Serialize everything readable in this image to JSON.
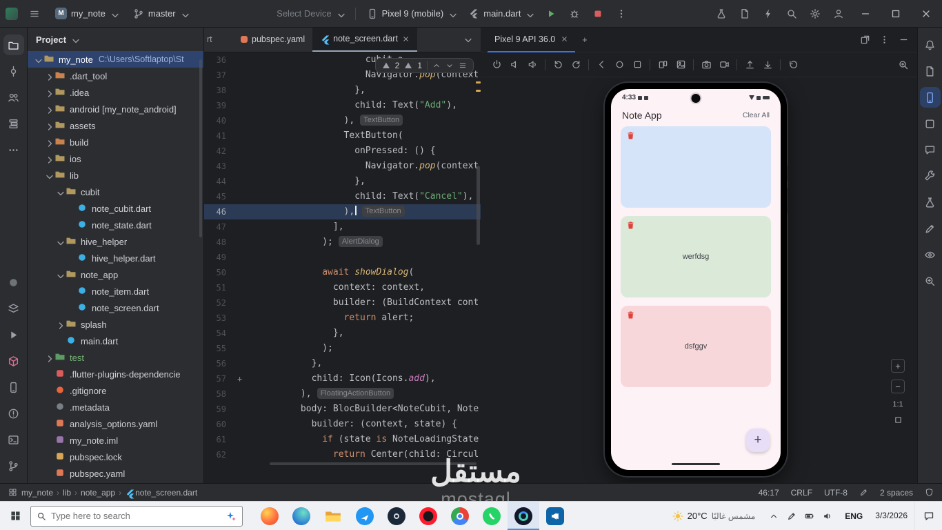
{
  "titlebar": {
    "project_name": "my_note",
    "branch_name": "master",
    "device_placeholder": "Select Device",
    "device_name": "Pixel 9 (mobile)",
    "run_config": "main.dart"
  },
  "left_strip": [
    {
      "name": "project",
      "icon": "folder",
      "active": true
    },
    {
      "name": "commit",
      "icon": "commit"
    },
    {
      "name": "pull-requests",
      "icon": "people"
    },
    {
      "name": "structure",
      "icon": "structure"
    },
    {
      "name": "more-tools",
      "icon": "more-h"
    },
    {
      "spacer": true
    },
    {
      "name": "app-inspection",
      "icon": "circle",
      "color": "#6f7378"
    },
    {
      "name": "build",
      "icon": "layers"
    },
    {
      "name": "services",
      "icon": "play"
    },
    {
      "name": "dependencies",
      "icon": "package",
      "color": "#d87093"
    },
    {
      "name": "device-explorer",
      "icon": "phone"
    },
    {
      "name": "problems",
      "icon": "warning-circle"
    },
    {
      "name": "terminal",
      "icon": "terminal"
    },
    {
      "name": "version-control",
      "icon": "branch"
    }
  ],
  "right_strip": [
    {
      "name": "notifications",
      "icon": "bell"
    },
    {
      "name": "gradle",
      "icon": "doc"
    },
    {
      "name": "running-devices",
      "icon": "phone",
      "active": true
    },
    {
      "name": "device-manager",
      "icon": "box"
    },
    {
      "name": "gemini-chat",
      "icon": "chat"
    },
    {
      "name": "assistant-tools",
      "icon": "wrench"
    },
    {
      "name": "app-quality-insights",
      "icon": "flask"
    },
    {
      "name": "logcat",
      "icon": "pencil"
    },
    {
      "name": "layout-inspector",
      "icon": "eye"
    },
    {
      "name": "plugins",
      "icon": "zoom"
    }
  ],
  "project_panel": {
    "title": "Project",
    "items": [
      {
        "label": "my_note",
        "path": "C:\\Users\\Softlaptop\\St",
        "level": 0,
        "chevron": "down",
        "icon": "folder",
        "selected": true
      },
      {
        "label": ".dart_tool",
        "level": 1,
        "chevron": "right",
        "icon": "folder-excluded"
      },
      {
        "label": ".idea",
        "level": 1,
        "chevron": "right",
        "icon": "folder"
      },
      {
        "label": "android [my_note_android]",
        "level": 1,
        "chevron": "right",
        "icon": "folder"
      },
      {
        "label": "assets",
        "level": 1,
        "chevron": "right",
        "icon": "folder"
      },
      {
        "label": "build",
        "level": 1,
        "chevron": "right",
        "icon": "folder-excluded"
      },
      {
        "label": "ios",
        "level": 1,
        "chevron": "right",
        "icon": "folder"
      },
      {
        "label": "lib",
        "level": 1,
        "chevron": "down",
        "icon": "folder"
      },
      {
        "label": "cubit",
        "level": 2,
        "chevron": "down",
        "icon": "folder"
      },
      {
        "label": "note_cubit.dart",
        "level": 3,
        "icon": "dart"
      },
      {
        "label": "note_state.dart",
        "level": 3,
        "icon": "dart"
      },
      {
        "label": "hive_helper",
        "level": 2,
        "chevron": "down",
        "icon": "folder"
      },
      {
        "label": "hive_helper.dart",
        "level": 3,
        "icon": "dart"
      },
      {
        "label": "note_app",
        "level": 2,
        "chevron": "down",
        "icon": "folder"
      },
      {
        "label": "note_item.dart",
        "level": 3,
        "icon": "dart"
      },
      {
        "label": "note_screen.dart",
        "level": 3,
        "icon": "dart"
      },
      {
        "label": "splash",
        "level": 2,
        "chevron": "right",
        "icon": "folder"
      },
      {
        "label": "main.dart",
        "level": 2,
        "icon": "dart"
      },
      {
        "label": "test",
        "level": 1,
        "chevron": "right",
        "icon": "folder-test",
        "cls": "green"
      },
      {
        "label": ".flutter-plugins-dependencie",
        "level": 1,
        "icon": "file-red"
      },
      {
        "label": ".gitignore",
        "level": 1,
        "icon": "file-git"
      },
      {
        "label": ".metadata",
        "level": 1,
        "icon": "file-gray"
      },
      {
        "label": "analysis_options.yaml",
        "level": 1,
        "icon": "file-yaml"
      },
      {
        "label": "my_note.iml",
        "level": 1,
        "icon": "file-iml"
      },
      {
        "label": "pubspec.lock",
        "level": 1,
        "icon": "file-lock"
      },
      {
        "label": "pubspec.yaml",
        "level": 1,
        "icon": "file-yaml"
      }
    ]
  },
  "editor": {
    "tabs": [
      {
        "label": "rt",
        "partial": true
      },
      {
        "label": "pubspec.yaml",
        "icon": "yaml"
      },
      {
        "label": "note_screen.dart",
        "icon": "flutter",
        "active": true
      }
    ],
    "inspection": {
      "errors": "2",
      "warnings": "1"
    },
    "lines": [
      {
        "n": 36,
        "ind": 24,
        "t": [
          [
            "cubit.a",
            ""
          ]
        ]
      },
      {
        "n": 37,
        "ind": 24,
        "t": [
          [
            "Navigator.",
            ""
          ],
          [
            "pop",
            "f"
          ],
          [
            "(context",
            ""
          ]
        ]
      },
      {
        "n": 38,
        "ind": 22,
        "t": [
          [
            "},",
            ""
          ]
        ]
      },
      {
        "n": 39,
        "ind": 22,
        "t": [
          [
            "child: Text(",
            ""
          ],
          [
            "\"Add\"",
            "s"
          ],
          [
            "),",
            ""
          ]
        ]
      },
      {
        "n": 40,
        "ind": 20,
        "t": [
          [
            "),",
            ""
          ]
        ],
        "inlay": "TextButton"
      },
      {
        "n": 41,
        "ind": 20,
        "t": [
          [
            "TextButton(",
            ""
          ]
        ]
      },
      {
        "n": 42,
        "ind": 22,
        "t": [
          [
            "onPressed: () {",
            ""
          ]
        ]
      },
      {
        "n": 43,
        "ind": 24,
        "t": [
          [
            "Navigator.",
            ""
          ],
          [
            "pop",
            "f"
          ],
          [
            "(context",
            ""
          ]
        ]
      },
      {
        "n": 44,
        "ind": 22,
        "t": [
          [
            "},",
            ""
          ]
        ]
      },
      {
        "n": 45,
        "ind": 22,
        "t": [
          [
            "child: Text(",
            ""
          ],
          [
            "\"Cancel\"",
            "s"
          ],
          [
            "),",
            ""
          ]
        ]
      },
      {
        "n": 46,
        "ind": 20,
        "t": [
          [
            "),",
            ""
          ]
        ],
        "inlay": "TextButton",
        "hl": true,
        "caret": true
      },
      {
        "n": 47,
        "ind": 18,
        "t": [
          [
            "],",
            ""
          ]
        ]
      },
      {
        "n": 48,
        "ind": 16,
        "t": [
          [
            ");",
            ""
          ]
        ],
        "inlay": "AlertDialog"
      },
      {
        "n": 49,
        "ind": 0,
        "t": []
      },
      {
        "n": 50,
        "ind": 16,
        "t": [
          [
            "await ",
            "k"
          ],
          [
            "showDialog",
            "f"
          ],
          [
            "(",
            ""
          ]
        ]
      },
      {
        "n": 51,
        "ind": 18,
        "t": [
          [
            "context: context,",
            ""
          ]
        ]
      },
      {
        "n": 52,
        "ind": 18,
        "t": [
          [
            "builder: (BuildContext cont",
            ""
          ]
        ]
      },
      {
        "n": 53,
        "ind": 20,
        "t": [
          [
            "return ",
            "k"
          ],
          [
            "alert;",
            ""
          ]
        ]
      },
      {
        "n": 54,
        "ind": 18,
        "t": [
          [
            "},",
            ""
          ]
        ]
      },
      {
        "n": 55,
        "ind": 16,
        "t": [
          [
            ");",
            ""
          ]
        ]
      },
      {
        "n": 56,
        "ind": 14,
        "t": [
          [
            "},",
            ""
          ]
        ]
      },
      {
        "n": 57,
        "ind": 14,
        "t": [
          [
            "child: Icon(Icons.",
            ""
          ],
          [
            "add",
            "p"
          ],
          [
            "),",
            ""
          ]
        ],
        "gutter": "+"
      },
      {
        "n": 58,
        "ind": 12,
        "t": [
          [
            "),",
            ""
          ]
        ],
        "inlay": "FloatingActionButton"
      },
      {
        "n": 59,
        "ind": 12,
        "t": [
          [
            "body: BlocBuilder<NoteCubit, Note",
            ""
          ]
        ]
      },
      {
        "n": 60,
        "ind": 14,
        "t": [
          [
            "builder: (context, state) {",
            ""
          ]
        ]
      },
      {
        "n": 61,
        "ind": 16,
        "t": [
          [
            "if ",
            "k"
          ],
          [
            "(state ",
            ""
          ],
          [
            "is ",
            "k"
          ],
          [
            "NoteLoadingState",
            ""
          ]
        ]
      },
      {
        "n": 62,
        "ind": 18,
        "t": [
          [
            "return ",
            "k"
          ],
          [
            "Center(child: Circul",
            ""
          ]
        ]
      }
    ]
  },
  "emulator": {
    "tab": "Pixel 9 API 36.0",
    "toolbar_groups": [
      [
        "power",
        "volume-down",
        "volume-up"
      ],
      [
        "rotate-left",
        "rotate-right"
      ],
      [
        "back",
        "home",
        "overview"
      ],
      [
        "fold",
        "snapshot"
      ],
      [
        "camera",
        "record"
      ],
      [
        "upload",
        "download"
      ],
      [
        "restore",
        "more"
      ]
    ],
    "zoom_label": "1:1",
    "phone": {
      "status_time": "4:33",
      "app_title": "Note App",
      "clear_all_label": "Clear All",
      "notes": [
        {
          "text": "",
          "color": "#d6e4f9"
        },
        {
          "text": "werfdsg",
          "color": "#dbe9d9"
        },
        {
          "text": "dsfggv",
          "color": "#f8d7da"
        }
      ],
      "fab_label": "+"
    }
  },
  "statusbar": {
    "breadcrumbs": [
      "my_note",
      "lib",
      "note_app",
      "note_screen.dart"
    ],
    "caret": "46:17",
    "line_sep": "CRLF",
    "encoding": "UTF-8",
    "indent": "2 spaces"
  },
  "taskbar": {
    "search_placeholder": "Type here to search",
    "apps": [
      "firefox",
      "edge",
      "explorer",
      "photos",
      "steam",
      "opera",
      "chrome",
      "whatsapp",
      "android-studio",
      "vscode"
    ],
    "active_app": "android-studio",
    "weather_temp": "20°C",
    "weather_desc": "مشمس غالبًا",
    "language": "ENG",
    "date": "3/3/2026"
  },
  "watermark": {
    "line1": "مستقل",
    "line2": "mostaql"
  },
  "colors": {
    "accent": "#3574f0",
    "run_green": "#5fad65",
    "stop_red": "#db5c5c",
    "warning": "#e5b84c",
    "error_stripe": "#d8a657"
  }
}
